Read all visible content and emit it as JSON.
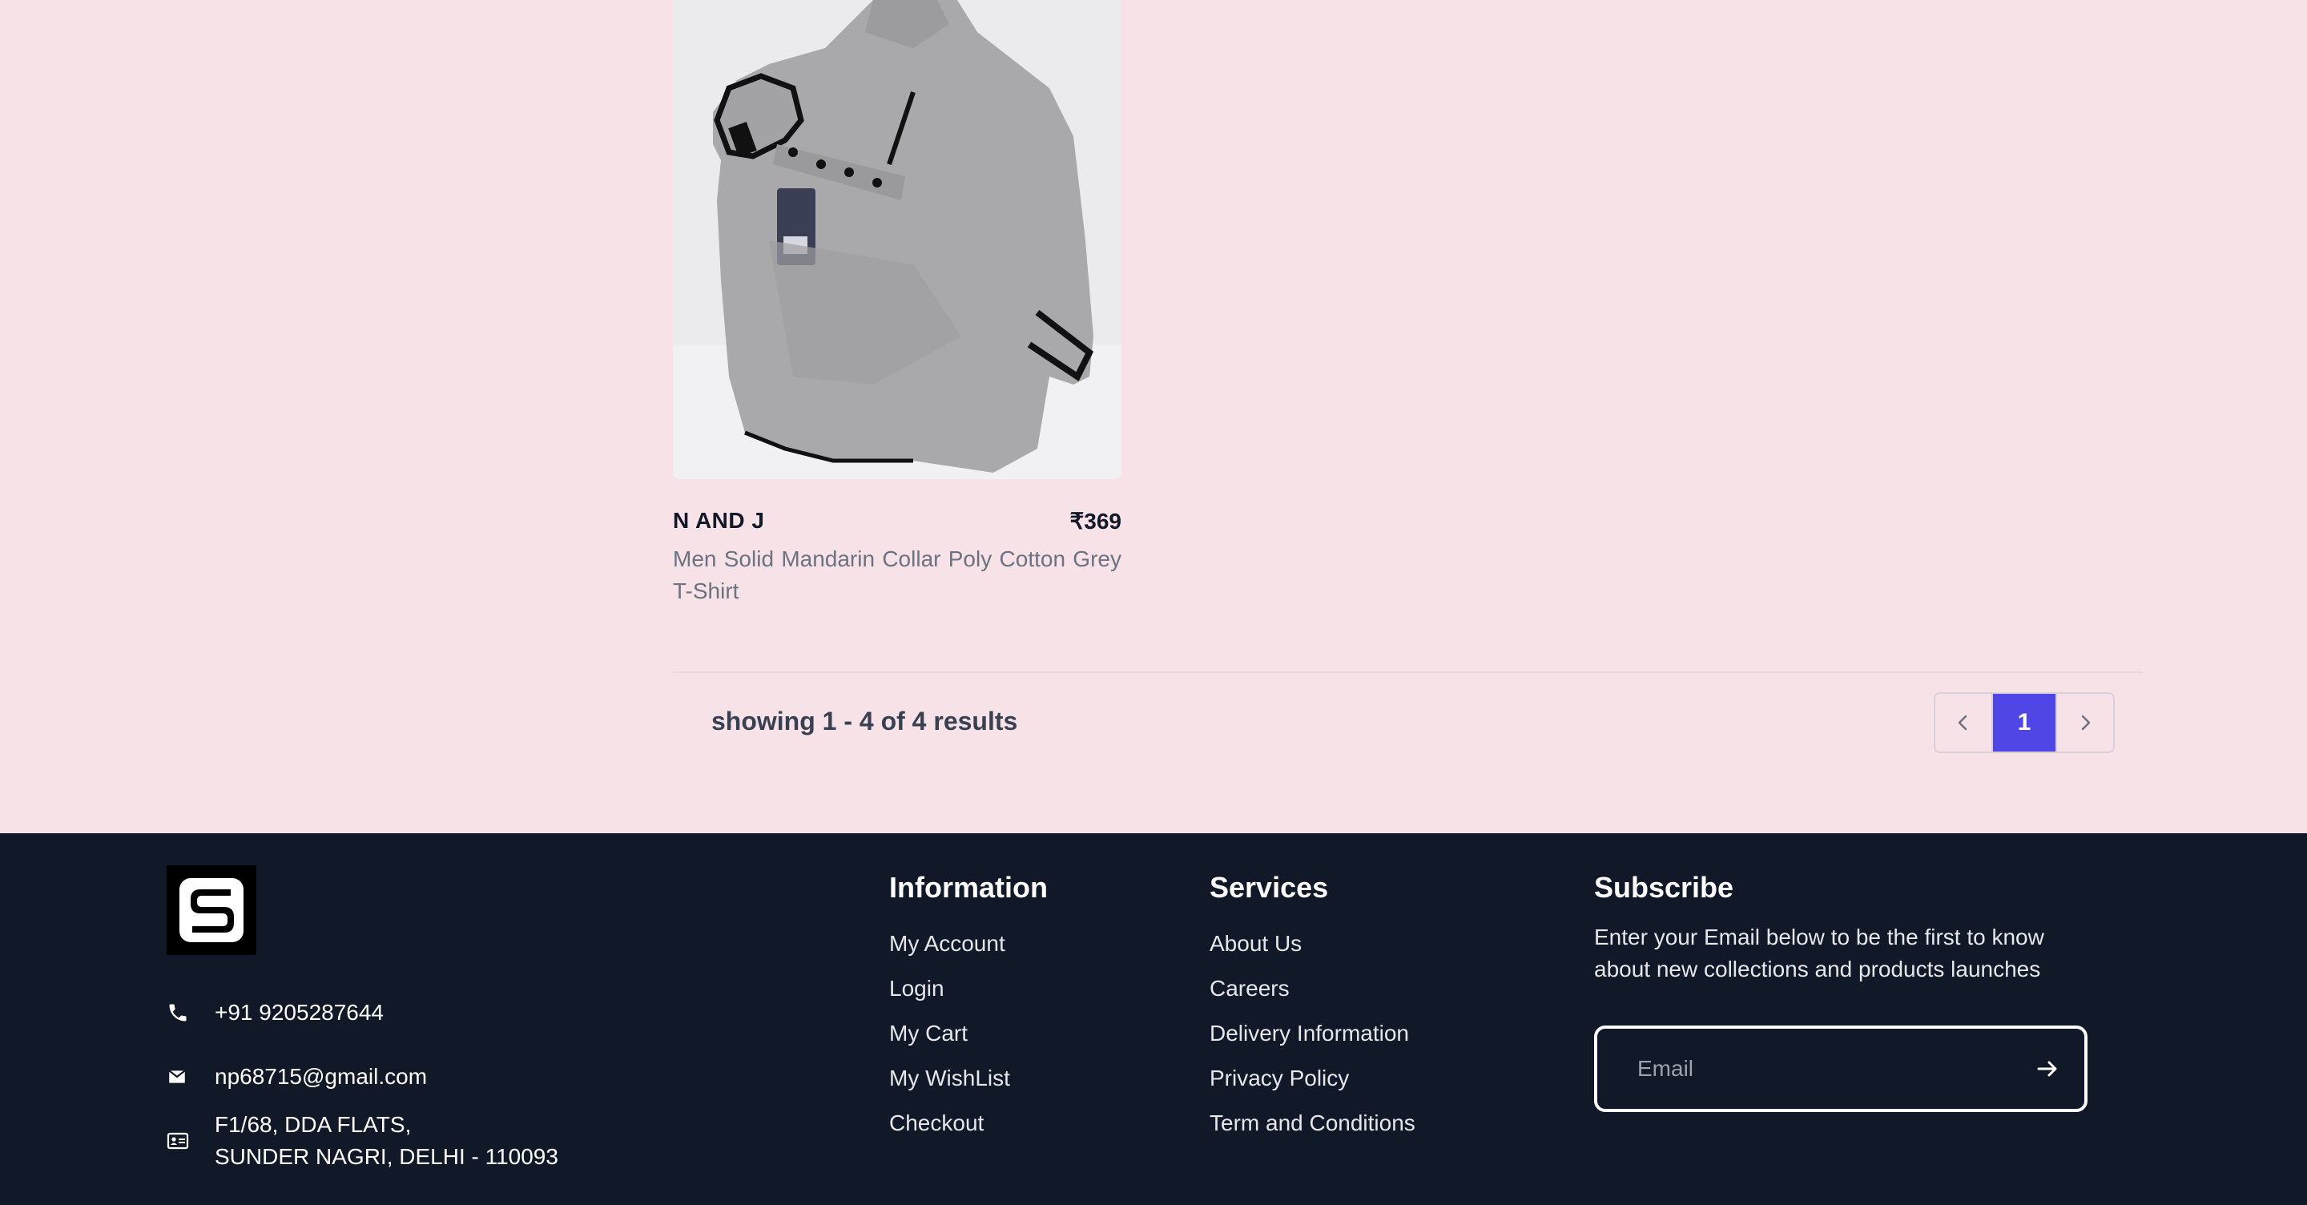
{
  "product": {
    "brand": "N AND J",
    "price": "₹369",
    "description": "Men Solid Mandarin Collar Poly Cotton Grey T-Shirt",
    "image_alt": "grey t-shirt product photo"
  },
  "results": {
    "text": "showing 1 - 4 of 4 results"
  },
  "pagination": {
    "current_page": "1",
    "prev_icon": "chevron-left-icon",
    "next_icon": "chevron-right-icon"
  },
  "footer": {
    "logo": "S",
    "contact": {
      "phone": "+91 9205287644",
      "email": "np68715@gmail.com",
      "address_line1": "F1/68, DDA FLATS,",
      "address_line2": "SUNDER NAGRI, DELHI - 110093"
    },
    "information": {
      "title": "Information",
      "links": [
        "My Account",
        "Login",
        "My Cart",
        "My WishList",
        "Checkout"
      ]
    },
    "services": {
      "title": "Services",
      "links": [
        "About Us",
        "Careers",
        "Delivery Information",
        "Privacy Policy",
        "Term and Conditions"
      ]
    },
    "subscribe": {
      "title": "Subscribe",
      "text": "Enter your Email below to be the first to know about new collections and products launches",
      "placeholder": "Email"
    }
  },
  "colors": {
    "page_bg": "#f7e3e7",
    "footer_bg": "#111827",
    "accent": "#4f46e5"
  }
}
